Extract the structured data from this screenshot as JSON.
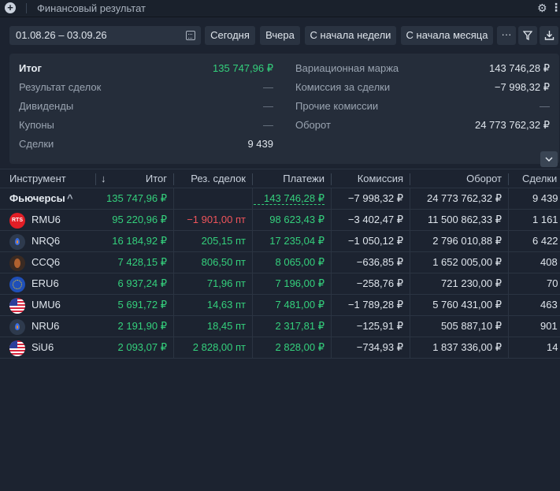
{
  "window": {
    "title": "Финансовый результат",
    "add_icon": "plus-circle-icon",
    "settings_icon": "gear-icon",
    "more_icon": "more-vertical-icon"
  },
  "toolbar": {
    "date_range": "01.08.26 – 03.09.26",
    "calendar_icon": "calendar-icon",
    "buttons": [
      "Сегодня",
      "Вчера",
      "С начала недели",
      "С начала месяца"
    ],
    "more_label": "···",
    "filter_icon": "filter-icon",
    "download_icon": "download-icon"
  },
  "summary": {
    "left": [
      {
        "label": "Итог",
        "value": "135 747,96 ₽"
      },
      {
        "label": "Результат сделок",
        "value": "—"
      },
      {
        "label": "Дивиденды",
        "value": "—"
      },
      {
        "label": "Купоны",
        "value": "—"
      },
      {
        "label": "Сделки",
        "value": "9 439"
      }
    ],
    "right": [
      {
        "label": "Вариационная маржа",
        "value": "143 746,28 ₽"
      },
      {
        "label": "Комиссия за сделки",
        "value": "−7 998,32 ₽"
      },
      {
        "label": "Прочие комиссии",
        "value": "—"
      },
      {
        "label": "Оборот",
        "value": "24 773 762,32 ₽"
      }
    ],
    "collapse_icon": "chevron-down-icon"
  },
  "table": {
    "headers": [
      "Инструмент",
      "↓",
      "Итог",
      "Рез. сделок",
      "Платежи",
      "Комиссия",
      "Оборот",
      "Сделки"
    ],
    "group": {
      "name": "Фьючерсы",
      "chevron": "^",
      "total": "135 747,96 ₽",
      "result": "",
      "payments": "143 746,28 ₽",
      "commission": "−7 998,32 ₽",
      "turnover": "24 773 762,32 ₽",
      "trades": "9 439"
    },
    "rows": [
      {
        "icon": "rts-logo-icon",
        "rts_label": "RTS",
        "name": "RMU6",
        "total": "95 220,96 ₽",
        "result": "−1 901,00 пт",
        "payments": "98 623,43 ₽",
        "commission": "−3 402,47 ₽",
        "turnover": "11 500 862,33 ₽",
        "trades": "1 161"
      },
      {
        "icon": "oil-drop-icon",
        "name": "NRQ6",
        "total": "16 184,92 ₽",
        "result": "205,15 пт",
        "payments": "17 235,04 ₽",
        "commission": "−1 050,12 ₽",
        "turnover": "2 796 010,88 ₽",
        "trades": "6 422"
      },
      {
        "icon": "cocoa-bean-icon",
        "name": "CCQ6",
        "total": "7 428,15 ₽",
        "result": "806,50 пт",
        "payments": "8 065,00 ₽",
        "commission": "−636,85 ₽",
        "turnover": "1 652 005,00 ₽",
        "trades": "408"
      },
      {
        "icon": "eu-flag-icon",
        "name": "ERU6",
        "total": "6 937,24 ₽",
        "result": "71,96 пт",
        "payments": "7 196,00 ₽",
        "commission": "−258,76 ₽",
        "turnover": "721 230,00 ₽",
        "trades": "70"
      },
      {
        "icon": "us-flag-icon",
        "name": "UMU6",
        "total": "5 691,72 ₽",
        "result": "14,63 пт",
        "payments": "7 481,00 ₽",
        "commission": "−1 789,28 ₽",
        "turnover": "5 760 431,00 ₽",
        "trades": "463"
      },
      {
        "icon": "oil-drop-icon",
        "name": "NRU6",
        "total": "2 191,90 ₽",
        "result": "18,45 пт",
        "payments": "2 317,81 ₽",
        "commission": "−125,91 ₽",
        "turnover": "505 887,10 ₽",
        "trades": "901"
      },
      {
        "icon": "us-flag-icon",
        "name": "SiU6",
        "total": "2 093,07 ₽",
        "result": "2 828,00 пт",
        "payments": "2 828,00 ₽",
        "commission": "−734,93 ₽",
        "turnover": "1 837 336,00 ₽",
        "trades": "14"
      }
    ]
  },
  "colors": {
    "background": "#1c2330",
    "panel": "#252d3a",
    "positive": "#34d07c",
    "negative": "#f0545b"
  }
}
